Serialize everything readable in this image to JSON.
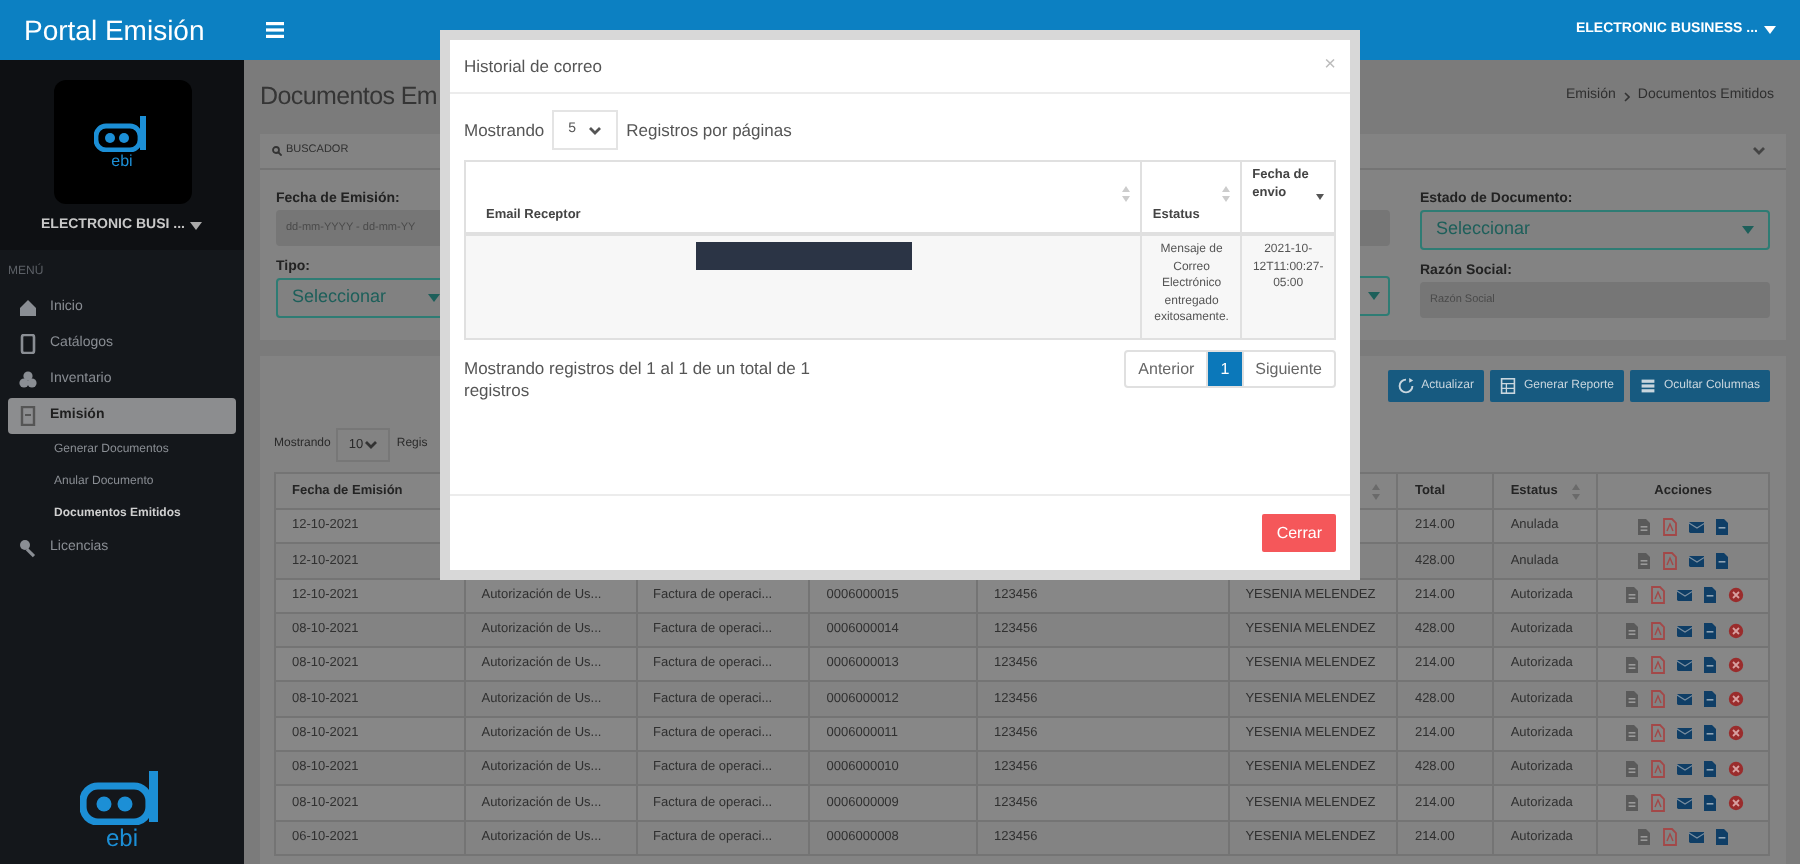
{
  "topbar": {
    "title": "Portal Emisión",
    "account": "ELECTRONIC BUSINESS ..."
  },
  "sidebar": {
    "logo_text": "ebi",
    "account": "ELECTRONIC BUSI ...",
    "menu_label": "MENÚ",
    "items": [
      {
        "label": "Inicio",
        "selected": false
      },
      {
        "label": "Catálogos",
        "selected": false
      },
      {
        "label": "Inventario",
        "selected": false
      },
      {
        "label": "Emisión",
        "selected": true,
        "children": [
          {
            "label": "Generar Documentos",
            "selected": false
          },
          {
            "label": "Anular Documento",
            "selected": false
          },
          {
            "label": "Documentos Emitidos",
            "selected": true
          }
        ]
      },
      {
        "label": "Licencias",
        "selected": false
      }
    ],
    "footer_logo_text": "ebi"
  },
  "page": {
    "title": "Documentos Em",
    "breadcrumb": [
      "Emisión",
      "Documentos Emitidos"
    ]
  },
  "search_panel": {
    "title": "BUSCADOR",
    "left_fields": [
      {
        "label": "Fecha de Emisión:",
        "kind": "text",
        "placeholder": "dd-mm-YYYY - dd-mm-YY"
      },
      {
        "label": "Tipo:",
        "kind": "select",
        "value": "Seleccionar"
      }
    ],
    "right_fields": [
      {
        "label": "Estado de Documento:",
        "kind": "select",
        "value": "Seleccionar"
      },
      {
        "label": "Razón Social:",
        "kind": "text",
        "placeholder": "Razón Social"
      }
    ]
  },
  "toolbar": {
    "buttons": [
      "Actualizar",
      "Generar Reporte",
      "Ocultar Columnas"
    ]
  },
  "table": {
    "length_label": "Mostrando",
    "length_value": "10",
    "length_suffix": "Regis",
    "columns": {
      "column_1": "Fecha de Emisión",
      "column_7": "Total",
      "column_8": "Estatus",
      "column_9": "Acciones"
    },
    "rows": [
      {
        "column_1": "12-10-2021",
        "column_7": "214.00",
        "column_8": "Anulada",
        "can_cancel": false
      },
      {
        "column_1": "12-10-2021",
        "column_7": "428.00",
        "column_8": "Anulada",
        "can_cancel": false
      },
      {
        "column_1": "12-10-2021",
        "column_2": "Autorización de Us...",
        "column_3": "Factura de operaci...",
        "column_4": "0006000015",
        "column_5": "123456",
        "column_6": "YESENIA MELENDEZ",
        "column_7": "214.00",
        "column_8": "Autorizada",
        "can_cancel": true
      },
      {
        "column_1": "08-10-2021",
        "column_2": "Autorización de Us...",
        "column_3": "Factura de operaci...",
        "column_4": "0006000014",
        "column_5": "123456",
        "column_6": "YESENIA MELENDEZ",
        "column_7": "428.00",
        "column_8": "Autorizada",
        "can_cancel": true
      },
      {
        "column_1": "08-10-2021",
        "column_2": "Autorización de Us...",
        "column_3": "Factura de operaci...",
        "column_4": "0006000013",
        "column_5": "123456",
        "column_6": "YESENIA MELENDEZ",
        "column_7": "214.00",
        "column_8": "Autorizada",
        "can_cancel": true
      },
      {
        "column_1": "08-10-2021",
        "column_2": "Autorización de Us...",
        "column_3": "Factura de operaci...",
        "column_4": "0006000012",
        "column_5": "123456",
        "column_6": "YESENIA MELENDEZ",
        "column_7": "428.00",
        "column_8": "Autorizada",
        "can_cancel": true
      },
      {
        "column_1": "08-10-2021",
        "column_2": "Autorización de Us...",
        "column_3": "Factura de operaci...",
        "column_4": "0006000011",
        "column_5": "123456",
        "column_6": "YESENIA MELENDEZ",
        "column_7": "214.00",
        "column_8": "Autorizada",
        "can_cancel": true
      },
      {
        "column_1": "08-10-2021",
        "column_2": "Autorización de Us...",
        "column_3": "Factura de operaci...",
        "column_4": "0006000010",
        "column_5": "123456",
        "column_6": "YESENIA MELENDEZ",
        "column_7": "428.00",
        "column_8": "Autorizada",
        "can_cancel": true
      },
      {
        "column_1": "08-10-2021",
        "column_2": "Autorización de Us...",
        "column_3": "Factura de operaci...",
        "column_4": "0006000009",
        "column_5": "123456",
        "column_6": "YESENIA MELENDEZ",
        "column_7": "214.00",
        "column_8": "Autorizada",
        "can_cancel": true
      },
      {
        "column_1": "06-10-2021",
        "column_2": "Autorización de Us...",
        "column_3": "Factura de operaci...",
        "column_4": "0006000008",
        "column_5": "123456",
        "column_6": "YESENIA MELENDEZ",
        "column_7": "214.00",
        "column_8": "Autorizada",
        "can_cancel": false
      }
    ]
  },
  "modal": {
    "title": "Historial de correo",
    "close": "×",
    "length_label": "Mostrando",
    "length_value": "5",
    "length_suffix": "Registros por páginas",
    "columns": [
      "Email Receptor",
      "Estatus",
      "Fecha de envio"
    ],
    "rows": [
      {
        "email_redacted": true,
        "status": "Mensaje de Correo Electrónico entregado exitosamente.",
        "date": "2021-10-12T11:00:27-05:00"
      }
    ],
    "info": "Mostrando registros del 1 al 1 de un total de 1 registros",
    "pagination": [
      {
        "label": "Anterior",
        "selected": false
      },
      {
        "label": "1",
        "selected": true
      },
      {
        "label": "Siguiente",
        "selected": false
      }
    ],
    "close_button": "Cerrar"
  }
}
